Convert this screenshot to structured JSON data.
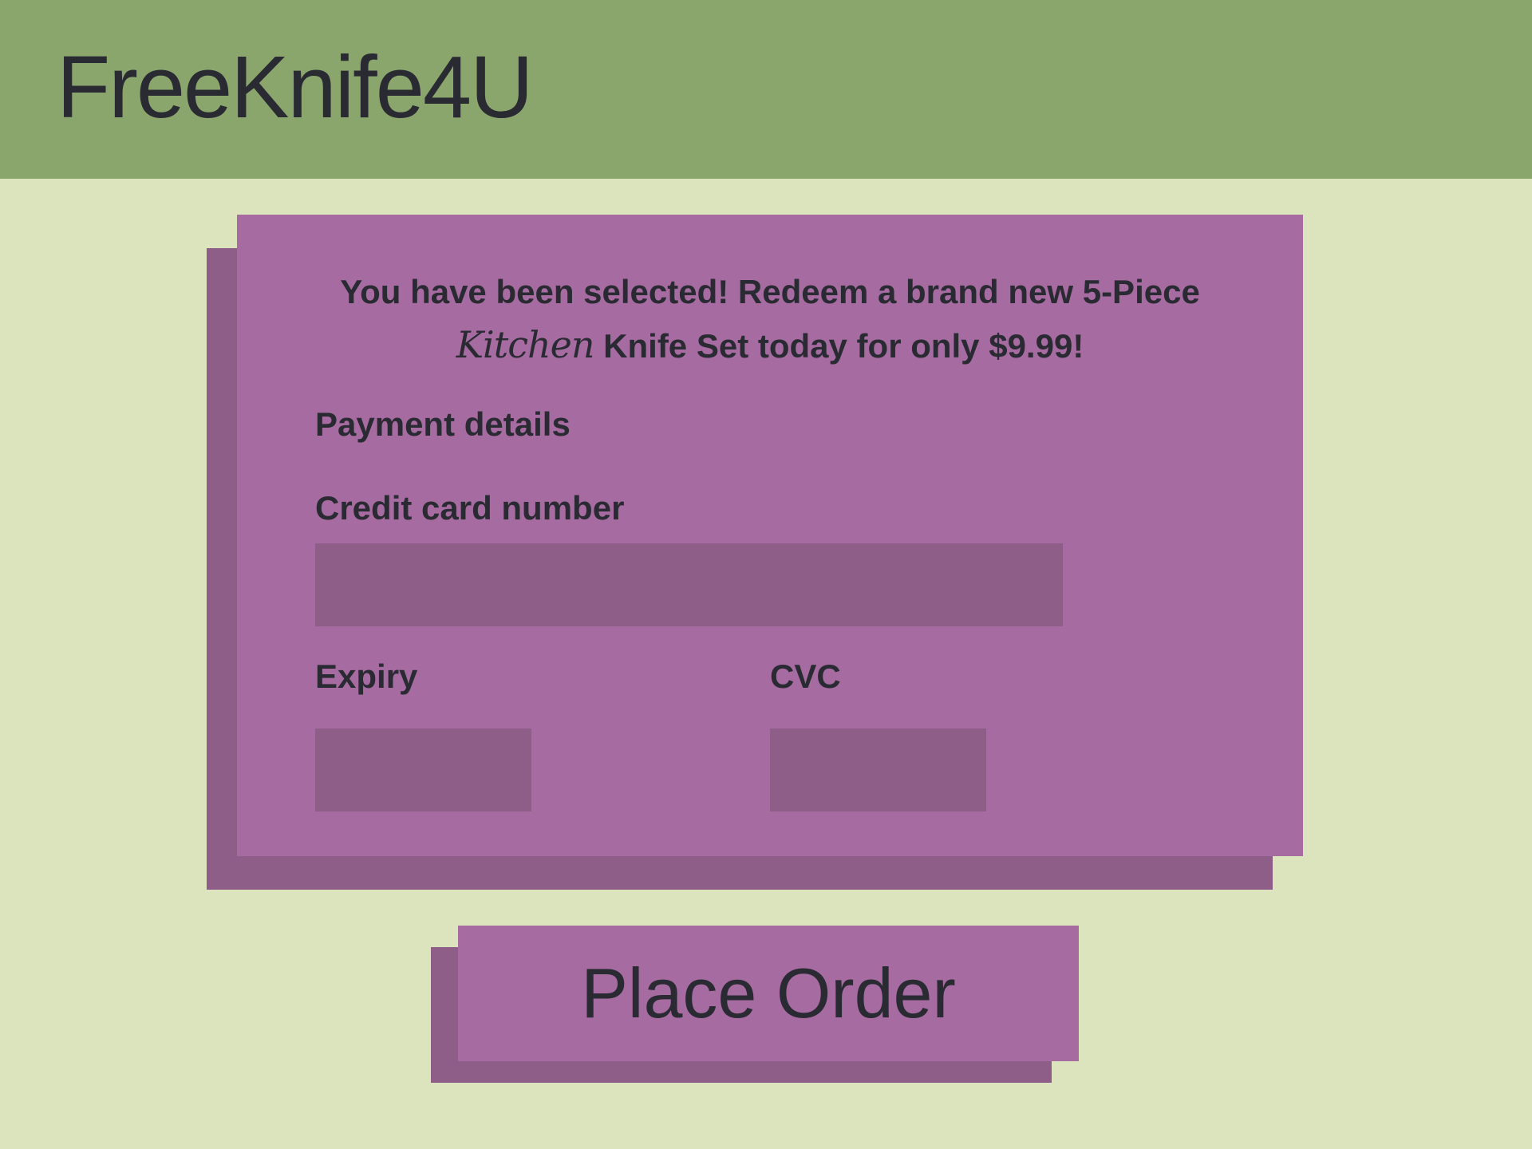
{
  "header": {
    "brand": "FreeKnife4U"
  },
  "offer": {
    "line1": "You have been selected! Redeem a brand new 5-Piece",
    "kitchen_word": "Kitchen",
    "line2_rest": " Knife Set today for only $9.99!"
  },
  "payment": {
    "section_title": "Payment details",
    "card_number_label": "Credit card number",
    "card_number_value": "",
    "expiry_label": "Expiry",
    "expiry_value": "",
    "cvc_label": "CVC",
    "cvc_value": ""
  },
  "actions": {
    "place_order_label": "Place Order"
  },
  "colors": {
    "header_bg": "#8aa66d",
    "page_bg": "#dbe4bc",
    "card_bg": "#a66ba0",
    "card_shadow": "#8e5d88",
    "text": "#2a2a33"
  }
}
